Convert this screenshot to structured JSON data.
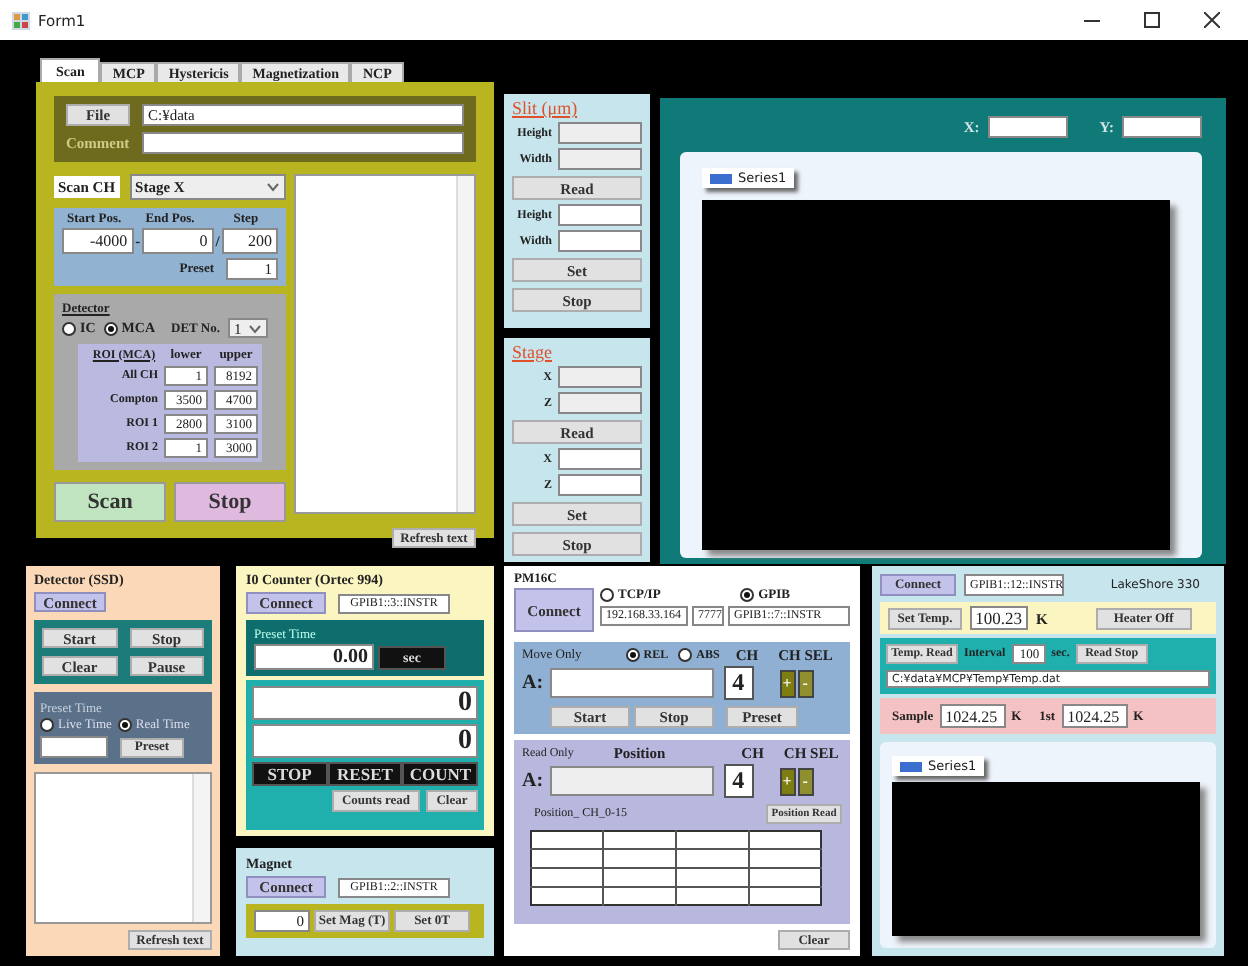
{
  "window": {
    "title": "Form1"
  },
  "tabs": [
    {
      "label": "Scan",
      "selected": true
    },
    {
      "label": "MCP",
      "selected": false
    },
    {
      "label": "Hystericis",
      "selected": false
    },
    {
      "label": "Magnetization",
      "selected": false
    },
    {
      "label": "NCP",
      "selected": false
    }
  ],
  "scan": {
    "file_button": "File",
    "path": "C:¥data",
    "comment_label": "Comment",
    "scan_ch_label": "Scan CH",
    "scan_ch": "Stage X",
    "start_label": "Start Pos.",
    "end_label": "End Pos.",
    "step_label": "Step",
    "start": "-4000",
    "separator_1": "-",
    "end": "0",
    "separator_2": "/",
    "step": "200",
    "preset_label": "Preset",
    "preset": "1",
    "detector": {
      "title": "Detector",
      "options": [
        {
          "label": "IC",
          "selected": false
        },
        {
          "label": "MCA",
          "selected": true
        }
      ],
      "det_no_label": "DET No.",
      "det_no": "1"
    },
    "roi": {
      "title": "ROI (MCA)",
      "columns": [
        "lower",
        "upper"
      ],
      "rows": [
        {
          "label": "All CH",
          "lower": "1",
          "upper": "8192"
        },
        {
          "label": "Compton",
          "lower": "3500",
          "upper": "4700"
        },
        {
          "label": "ROI 1",
          "lower": "2800",
          "upper": "3100"
        },
        {
          "label": "ROI 2",
          "lower": "1",
          "upper": "3000"
        }
      ]
    },
    "scan_button": "Scan",
    "stop_button": "Stop",
    "refresh_button": "Refresh text"
  },
  "slit": {
    "title": "Slit (μm)",
    "read_fields": [
      "Height",
      "Width"
    ],
    "read_button": "Read",
    "set_fields": [
      "Height",
      "Width"
    ],
    "set_button": "Set",
    "stop_button": "Stop"
  },
  "stage": {
    "title": "Stage",
    "read_fields": [
      "X",
      "Z"
    ],
    "read_button": "Read",
    "set_fields": [
      "X",
      "Z"
    ],
    "set_button": "Set",
    "stop_button": "Stop"
  },
  "plot": {
    "x_label": "X:",
    "y_label": "Y:",
    "legend": "Series1"
  },
  "detector_ssd": {
    "title": "Detector (SSD)",
    "connect": "Connect",
    "buttons": [
      "Start",
      "Stop",
      "Clear",
      "Pause"
    ],
    "preset_title": "Preset Time",
    "modes": [
      {
        "label": "Live Time",
        "selected": false
      },
      {
        "label": "Real Time",
        "selected": true
      }
    ],
    "preset_button": "Preset",
    "refresh_button": "Refresh text"
  },
  "io_counter": {
    "title": "I0 Counter (Ortec 994)",
    "connect": "Connect",
    "address": "GPIB1::3::INSTR",
    "preset_title": "Preset Time",
    "preset_value": "0.00",
    "unit": "sec",
    "counts": [
      "0",
      "0"
    ],
    "buttons": [
      "STOP",
      "RESET",
      "COUNT"
    ],
    "counts_read": "Counts read",
    "clear": "Clear"
  },
  "magnet": {
    "title": "Magnet",
    "connect": "Connect",
    "address": "GPIB1::2::INSTR",
    "value": "0",
    "set_mag": "Set Mag (T)",
    "set_zero": "Set 0T"
  },
  "pm16c": {
    "title": "PM16C",
    "connect": "Connect",
    "interfaces": [
      {
        "label": "TCP/IP",
        "selected": false
      },
      {
        "label": "GPIB",
        "selected": true
      }
    ],
    "ip": "192.168.33.164",
    "port": "7777",
    "address": "GPIB1::7::INSTR",
    "move": {
      "title": "Move Only",
      "modes": [
        {
          "label": "REL",
          "selected": true
        },
        {
          "label": "ABS",
          "selected": false
        }
      ],
      "ch_label": "CH",
      "ch_sel_label": "CH SEL",
      "axis": "A:",
      "ch": "4",
      "plus": "+",
      "minus": "-",
      "buttons": [
        "Start",
        "Stop",
        "Preset"
      ]
    },
    "read": {
      "title": "Read Only",
      "position_label": "Position",
      "ch_label": "CH",
      "ch_sel_label": "CH SEL",
      "axis": "A:",
      "ch": "4",
      "plus": "+",
      "minus": "-",
      "table_title": "Position_ CH_0-15",
      "position_read": "Position Read"
    },
    "clear": "Clear"
  },
  "lakeshore": {
    "connect": "Connect",
    "address": "GPIB1::12::INSTR",
    "model": "LakeShore 330",
    "set_temp": "Set Temp.",
    "setpoint": "100.23",
    "unit": "K",
    "heater": "Heater Off",
    "temp_read": "Temp. Read",
    "interval_label": "Interval",
    "interval": "100",
    "interval_unit": "sec.",
    "read_stop": "Read Stop",
    "file": "C:¥data¥MCP¥Temp¥Temp.dat",
    "sample_label": "Sample",
    "sample": "1024.25",
    "sample_unit": "K",
    "first_label": "1st",
    "first": "1024.25",
    "first_unit": "K",
    "legend": "Series1"
  }
}
